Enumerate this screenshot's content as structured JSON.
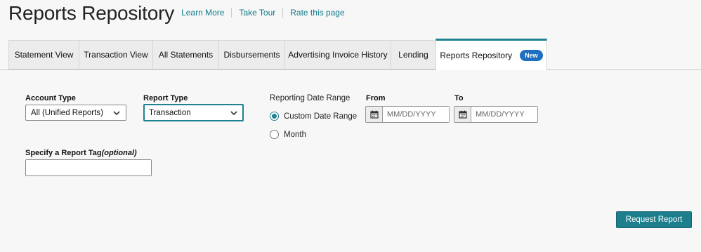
{
  "header": {
    "title": "Reports Repository",
    "links": [
      "Learn More",
      "Take Tour",
      "Rate this page"
    ]
  },
  "tabs": [
    {
      "label": "Statement View"
    },
    {
      "label": "Transaction View"
    },
    {
      "label": "All Statements"
    },
    {
      "label": "Disbursements"
    },
    {
      "label": "Advertising Invoice History"
    },
    {
      "label": "Lending"
    },
    {
      "label": "Reports Repository",
      "badge": "New",
      "active": true
    }
  ],
  "form": {
    "account_type": {
      "label": "Account Type",
      "value": "All (Unified Reports)"
    },
    "report_type": {
      "label": "Report Type",
      "value": "Transaction"
    },
    "date_range": {
      "label": "Reporting Date Range",
      "options": [
        {
          "label": "Custom Date Range",
          "checked": true
        },
        {
          "label": "Month",
          "checked": false
        }
      ]
    },
    "from": {
      "label": "From",
      "placeholder": "MM/DD/YYYY"
    },
    "to": {
      "label": "To",
      "placeholder": "MM/DD/YYYY"
    },
    "report_tag": {
      "label": "Specify a Report Tag",
      "optional_label": "(optional)",
      "value": ""
    }
  },
  "actions": {
    "request_report": "Request Report"
  },
  "colors": {
    "accent": "#1f8291",
    "badge": "#1f6fbf",
    "link": "#107a8a"
  },
  "icons": {
    "calendar": "calendar-icon",
    "dropdown": "chevron-down-icon"
  }
}
